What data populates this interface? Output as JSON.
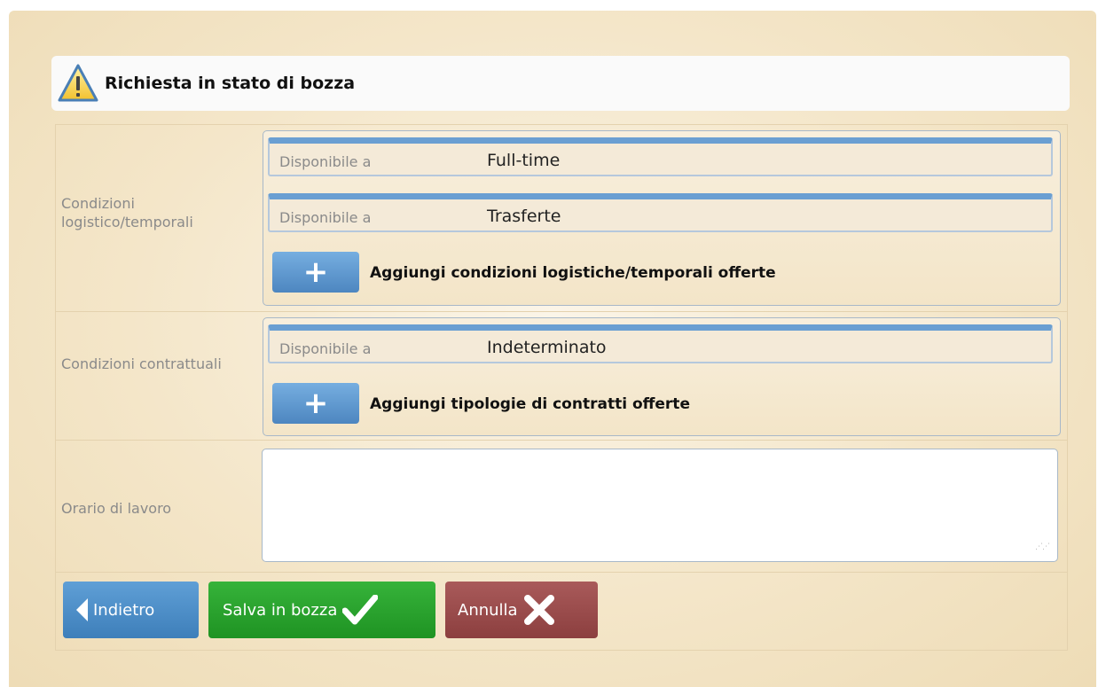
{
  "alert": {
    "title": "Richiesta in stato di bozza",
    "icon": "warning-icon"
  },
  "rows": {
    "logistic": {
      "label": "Condizioni logistico/temporali",
      "items": [
        {
          "key": "Disponibile a",
          "value": "Full-time"
        },
        {
          "key": "Disponibile a",
          "value": "Trasferte"
        }
      ],
      "add_label": "Aggiungi condizioni logistiche/temporali offerte"
    },
    "contract": {
      "label": "Condizioni contrattuali",
      "items": [
        {
          "key": "Disponibile a",
          "value": "Indeterminato"
        }
      ],
      "add_label": "Aggiungi tipologie di contratti offerte"
    },
    "hours": {
      "label": "Orario di lavoro",
      "value": ""
    }
  },
  "buttons": {
    "back": "Indietro",
    "save": "Salva in bozza",
    "cancel": "Annulla"
  },
  "colors": {
    "accent_blue": "#4d86c0",
    "save_green": "#1f9323",
    "cancel_red": "#8c3f3f"
  }
}
